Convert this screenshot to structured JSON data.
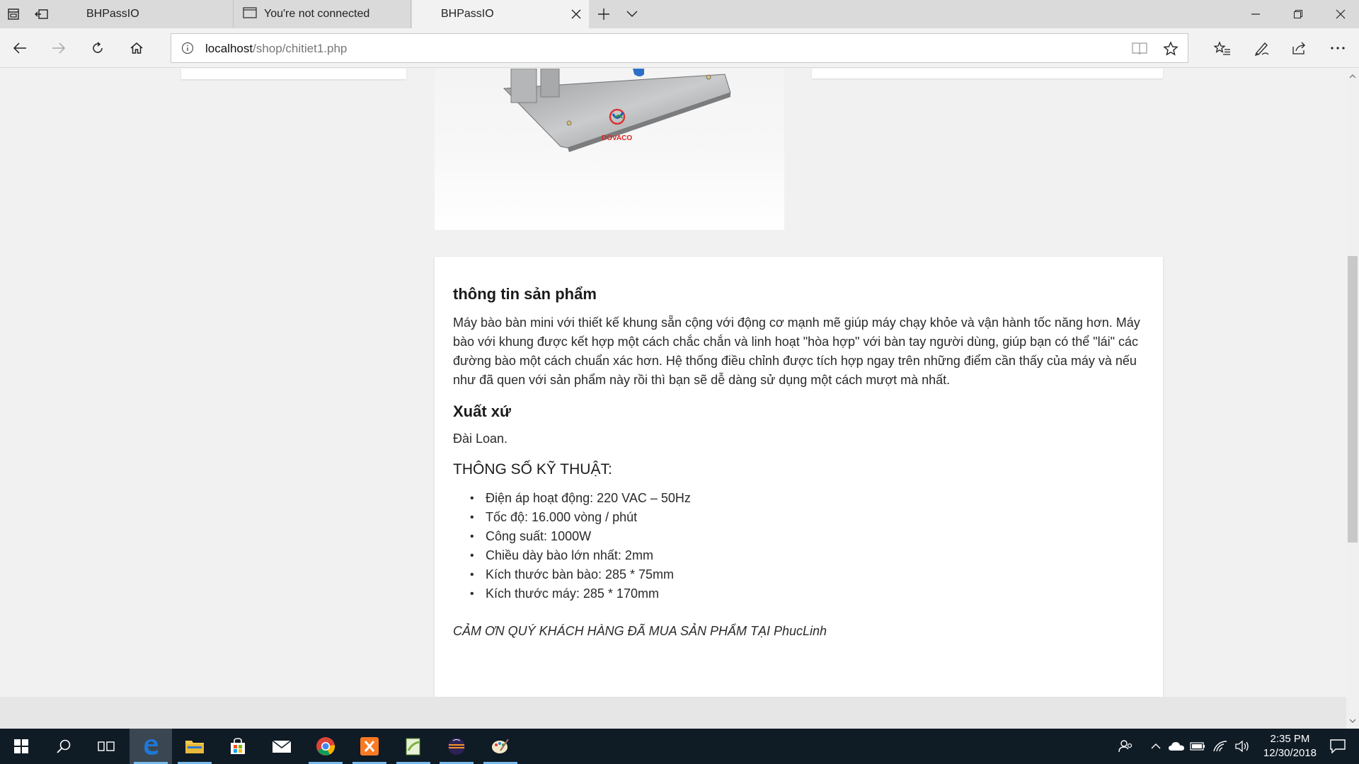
{
  "browser": {
    "tabs": [
      {
        "title": "BHPassIO",
        "active": false
      },
      {
        "title": "You're not connected",
        "active": false
      },
      {
        "title": "BHPassIO",
        "active": true
      }
    ],
    "address": {
      "host": "localhost",
      "path": "/shop/chitiet1.php"
    }
  },
  "product": {
    "image_logo_text": "DOVACO",
    "info_heading": "thông tin sản phẩm",
    "description": "Máy bào bàn mini với thiết kế khung sẵn cộng với động cơ mạnh mẽ giúp máy chạy khỏe và vận hành tốc năng hơn. Máy bào với khung được kết hợp một cách chắc chắn và linh hoạt \"hòa hợp\" với bàn tay người dùng, giúp bạn có thể \"lái\" các đường bào một cách chuẩn xác hơn. Hệ thống điều chỉnh được tích hợp ngay trên những điểm cần thấy của máy và nếu như đã quen với sản phẩm này rồi thì bạn sẽ dễ dàng sử dụng một cách mượt mà nhất.",
    "origin_heading": "Xuất xứ",
    "origin_value": "Đài Loan.",
    "specs_heading": "THÔNG SỐ KỸ THUẬT:",
    "specs": [
      "Điện áp hoạt động: 220 VAC – 50Hz",
      "Tốc độ: 16.000 vòng / phút",
      "Công suất: 1000W",
      "Chiều dày bào lớn nhất: 2mm",
      "Kích thước bàn bào: 285 * 75mm",
      "Kích thước máy: 285 * 170mm"
    ],
    "thanks": "CẢM ƠN QUÝ KHÁCH HÀNG ĐÃ MUA SẢN PHẨM TẠI PhucLinh"
  },
  "taskbar": {
    "clock_time": "2:35 PM",
    "clock_date": "12/30/2018",
    "apps": [
      "edge-icon",
      "file-explorer-icon",
      "store-icon",
      "mail-icon",
      "chrome-icon",
      "xampp-icon",
      "notepad-plus-icon",
      "eclipse-icon",
      "paint-icon"
    ]
  },
  "colors": {
    "taskbar": "#0f1b25",
    "accent": "#76b9ed",
    "edge_blue": "#1e78d7"
  }
}
